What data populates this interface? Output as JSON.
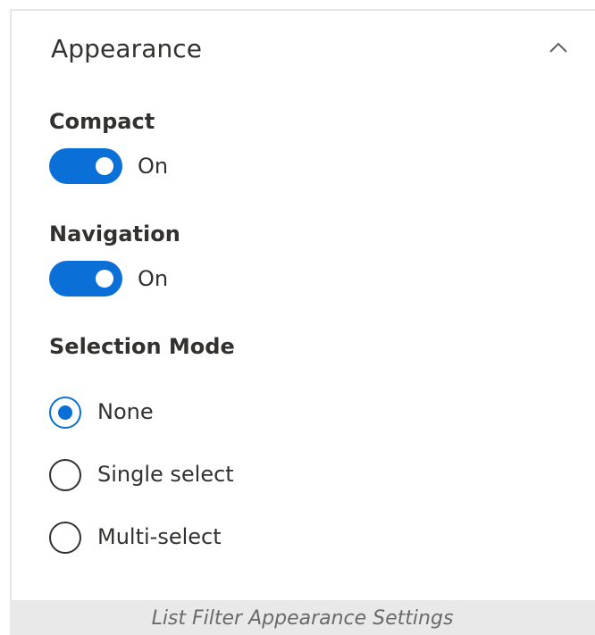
{
  "section": {
    "title": "Appearance",
    "collapse_icon": "chevron-up-icon"
  },
  "compact": {
    "label": "Compact",
    "state": "On",
    "checked": true
  },
  "navigation": {
    "label": "Navigation",
    "state": "On",
    "checked": true
  },
  "selection_mode": {
    "label": "Selection Mode",
    "options": [
      {
        "label": "None",
        "checked": true
      },
      {
        "label": "Single select",
        "checked": false
      },
      {
        "label": "Multi-select",
        "checked": false
      }
    ]
  },
  "caption": "List Filter Appearance Settings",
  "colors": {
    "accent": "#0a6fd6",
    "text": "#323130",
    "border": "#e6e6e6",
    "caption_bg": "#e9e9e9"
  }
}
